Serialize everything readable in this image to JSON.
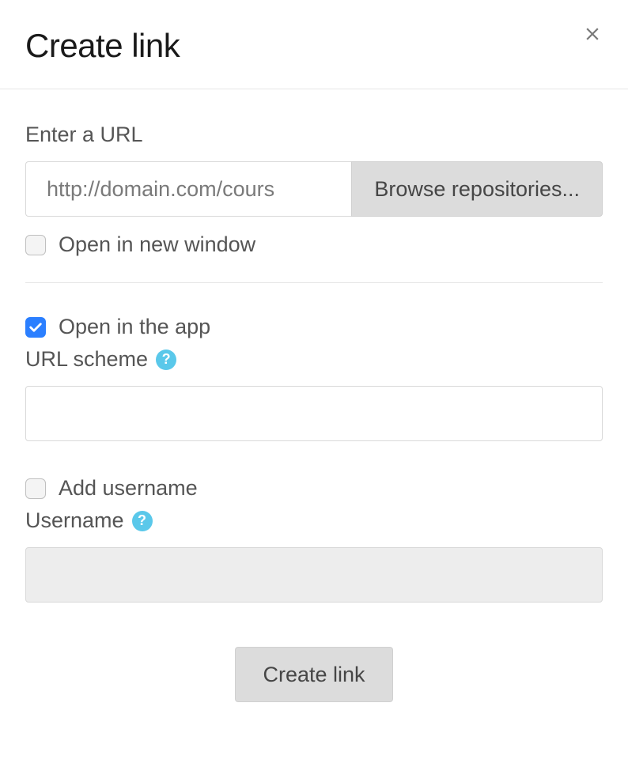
{
  "header": {
    "title": "Create link"
  },
  "form": {
    "url_section": {
      "label": "Enter a URL",
      "placeholder": "http://domain.com/cours",
      "browse_label": "Browse repositories...",
      "open_new_window": {
        "label": "Open in new window",
        "checked": false
      }
    },
    "app_section": {
      "open_in_app": {
        "label": "Open in the app",
        "checked": true
      },
      "url_scheme_label": "URL scheme",
      "url_scheme_value": ""
    },
    "username_section": {
      "add_username": {
        "label": "Add username",
        "checked": false
      },
      "username_label": "Username",
      "username_value": ""
    }
  },
  "footer": {
    "submit_label": "Create link"
  },
  "icons": {
    "help": "?"
  }
}
